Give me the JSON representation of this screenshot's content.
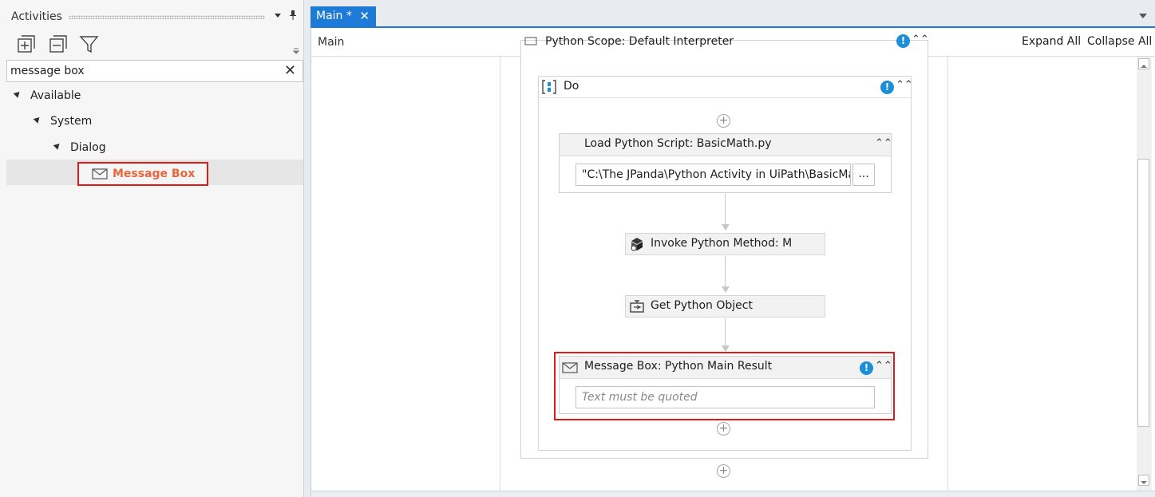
{
  "activities_panel": {
    "title": "Activities",
    "search": {
      "value": "message box",
      "clear_glyph": "✕"
    },
    "tree": {
      "available": "Available",
      "system": "System",
      "dialog": "Dialog",
      "message_box": "Message Box"
    },
    "icons": [
      "expand-all-icon",
      "collapse-all-icon",
      "filter-icon",
      "dropdown-icon",
      "pin-icon",
      "envelope-icon"
    ]
  },
  "document": {
    "tab_label": "Main *",
    "tab_close_glyph": "✕",
    "breadcrumb": "Main",
    "expand_all": "Expand All",
    "collapse_all": "Collapse All"
  },
  "workflow": {
    "python_scope_title": "Python Scope: Default Interpreter",
    "do_label": "Do",
    "load_script": {
      "title": "Load Python Script: BasicMath.py",
      "path_value": "\"C:\\The JPanda\\Python Activity in UiPath\\BasicMat",
      "browse_label": "..."
    },
    "invoke_method": {
      "title": "Invoke Python Method: Mai"
    },
    "get_object": {
      "title": "Get Python Object"
    },
    "message_box": {
      "title": "Message Box: Python Main Result",
      "text_placeholder": "Text must be quoted"
    },
    "warning_glyph": "!",
    "collapse_glyph": "⌃⌃"
  },
  "colors": {
    "tab_active": "#1d7ad6",
    "highlight_red": "#e01919",
    "selected_label": "#e8663c",
    "warning_blue": "#1c8fd8"
  }
}
